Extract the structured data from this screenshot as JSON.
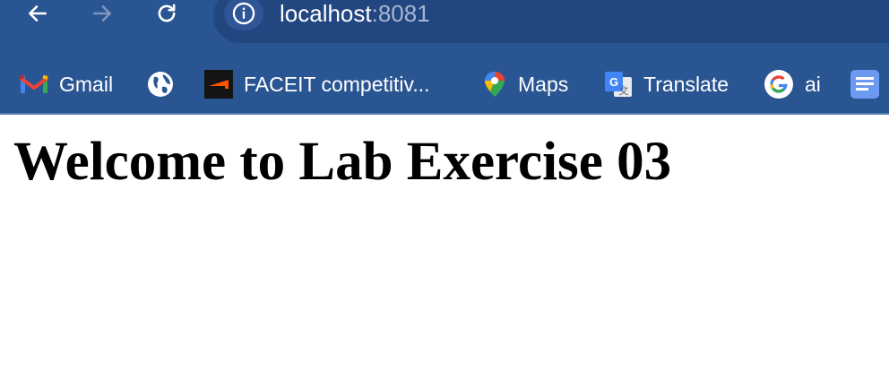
{
  "toolbar": {
    "back_icon": "arrow-left-icon",
    "forward_icon": "arrow-right-icon",
    "reload_icon": "reload-icon",
    "site_info_icon": "info-icon"
  },
  "address_bar": {
    "host": "localhost",
    "port": ":8081"
  },
  "bookmarks": [
    {
      "label": "Gmail",
      "icon": "gmail-icon"
    },
    {
      "label": "",
      "icon": "globe-icon"
    },
    {
      "label": "FACEIT competitiv...",
      "icon": "faceit-icon"
    },
    {
      "label": "Maps",
      "icon": "maps-icon"
    },
    {
      "label": "Translate",
      "icon": "translate-icon"
    },
    {
      "label": "ai",
      "icon": "google-icon"
    },
    {
      "label": "",
      "icon": "docs-icon"
    }
  ],
  "page": {
    "heading": "Welcome to Lab Exercise 03"
  },
  "colors": {
    "chrome_bg": "#2a5593",
    "omnibox_bg": "#22467f",
    "port_text": "#a7b6d1"
  }
}
